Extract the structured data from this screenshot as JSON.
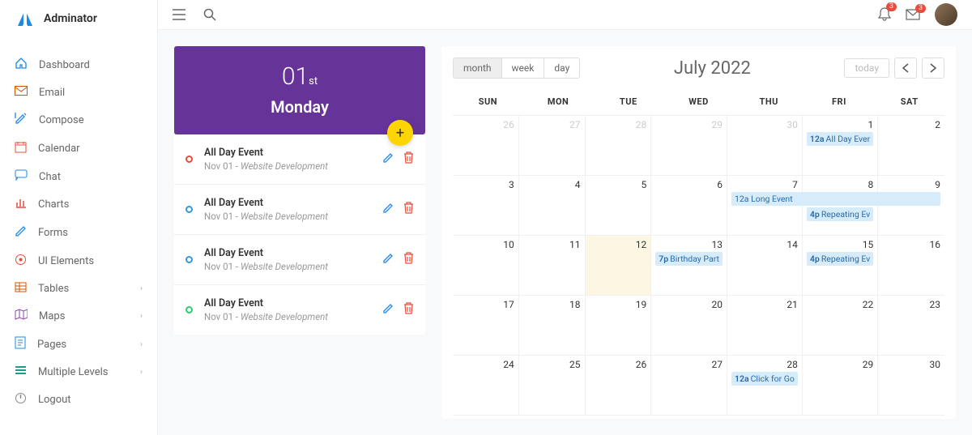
{
  "brand": "Adminator",
  "sidebar": {
    "items": [
      {
        "label": "Dashboard",
        "icon": "home",
        "expand": false
      },
      {
        "label": "Email",
        "icon": "mail",
        "expand": false
      },
      {
        "label": "Compose",
        "icon": "compose",
        "expand": false
      },
      {
        "label": "Calendar",
        "icon": "calendar",
        "expand": false
      },
      {
        "label": "Chat",
        "icon": "chat",
        "expand": false
      },
      {
        "label": "Charts",
        "icon": "chart",
        "expand": false
      },
      {
        "label": "Forms",
        "icon": "pencil",
        "expand": false
      },
      {
        "label": "UI Elements",
        "icon": "ui",
        "expand": false
      },
      {
        "label": "Tables",
        "icon": "table",
        "expand": true
      },
      {
        "label": "Maps",
        "icon": "map",
        "expand": true
      },
      {
        "label": "Pages",
        "icon": "pages",
        "expand": true
      },
      {
        "label": "Multiple Levels",
        "icon": "levels",
        "expand": true
      },
      {
        "label": "Logout",
        "icon": "logout",
        "expand": false
      }
    ]
  },
  "topbar": {
    "bell_badge": "3",
    "mail_badge": "3"
  },
  "hero": {
    "date": "01",
    "suffix": "st",
    "day": "Monday"
  },
  "events": [
    {
      "title": "All Day Event",
      "date": "Nov 01",
      "project": "Website Development",
      "color": "red"
    },
    {
      "title": "All Day Event",
      "date": "Nov 01",
      "project": "Website Development",
      "color": "blue"
    },
    {
      "title": "All Day Event",
      "date": "Nov 01",
      "project": "Website Development",
      "color": "blue"
    },
    {
      "title": "All Day Event",
      "date": "Nov 01",
      "project": "Website Development",
      "color": "green"
    }
  ],
  "calendar": {
    "view_buttons": [
      "month",
      "week",
      "day"
    ],
    "active_view": "month",
    "title": "July 2022",
    "today_label": "today",
    "dow": [
      "SUN",
      "MON",
      "TUE",
      "WED",
      "THU",
      "FRI",
      "SAT"
    ],
    "cells": [
      {
        "n": "26",
        "other": true
      },
      {
        "n": "27",
        "other": true
      },
      {
        "n": "28",
        "other": true
      },
      {
        "n": "29",
        "other": true
      },
      {
        "n": "30",
        "other": true
      },
      {
        "n": "1",
        "events": [
          {
            "time": "12a",
            "txt": "All Day Ever"
          }
        ]
      },
      {
        "n": "2"
      },
      {
        "n": "3"
      },
      {
        "n": "4"
      },
      {
        "n": "5"
      },
      {
        "n": "6"
      },
      {
        "n": "7",
        "spanstart": {
          "time": "12a",
          "txt": "Long Event"
        }
      },
      {
        "n": "8",
        "events": [
          {
            "time": "4p",
            "txt": "Repeating Ev"
          }
        ],
        "spanmid": true
      },
      {
        "n": "9",
        "spanend": true
      },
      {
        "n": "10"
      },
      {
        "n": "11"
      },
      {
        "n": "12",
        "today": true
      },
      {
        "n": "13",
        "events": [
          {
            "time": "7p",
            "txt": "Birthday Part"
          }
        ]
      },
      {
        "n": "14"
      },
      {
        "n": "15",
        "events": [
          {
            "time": "4p",
            "txt": "Repeating Ev"
          }
        ]
      },
      {
        "n": "16"
      },
      {
        "n": "17"
      },
      {
        "n": "18"
      },
      {
        "n": "19"
      },
      {
        "n": "20"
      },
      {
        "n": "21"
      },
      {
        "n": "22"
      },
      {
        "n": "23"
      },
      {
        "n": "24"
      },
      {
        "n": "25"
      },
      {
        "n": "26"
      },
      {
        "n": "27"
      },
      {
        "n": "28",
        "events": [
          {
            "time": "12a",
            "txt": "Click for Go"
          }
        ]
      },
      {
        "n": "29"
      },
      {
        "n": "30"
      }
    ]
  },
  "colors": {
    "purple": "#663399",
    "yellow": "#ffd500",
    "red": "#e74c3c",
    "blue": "#3498db",
    "green": "#2ecc71"
  }
}
